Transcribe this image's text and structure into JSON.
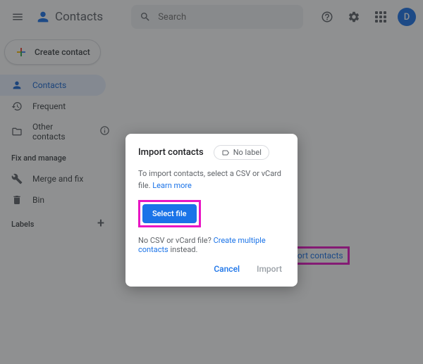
{
  "header": {
    "app_name": "Contacts",
    "search_placeholder": "Search",
    "avatar_initial": "D"
  },
  "sidebar": {
    "create_label": "Create contact",
    "nav": {
      "contacts": "Contacts",
      "frequent": "Frequent",
      "other": "Other contacts"
    },
    "section_fix": "Fix and manage",
    "merge": "Merge and fix",
    "bin": "Bin",
    "labels_title": "Labels"
  },
  "hints": {
    "create": "Create contact",
    "import": "Import contacts"
  },
  "modal": {
    "title": "Import contacts",
    "chip_label": "No label",
    "instruction_prefix": "To import contacts, select a CSV or vCard file. ",
    "learn_more": "Learn more",
    "select_file": "Select file",
    "no_file_prefix": "No CSV or vCard file? ",
    "create_multiple": "Create multiple contacts",
    "no_file_suffix": " instead.",
    "cancel": "Cancel",
    "import": "Import"
  }
}
